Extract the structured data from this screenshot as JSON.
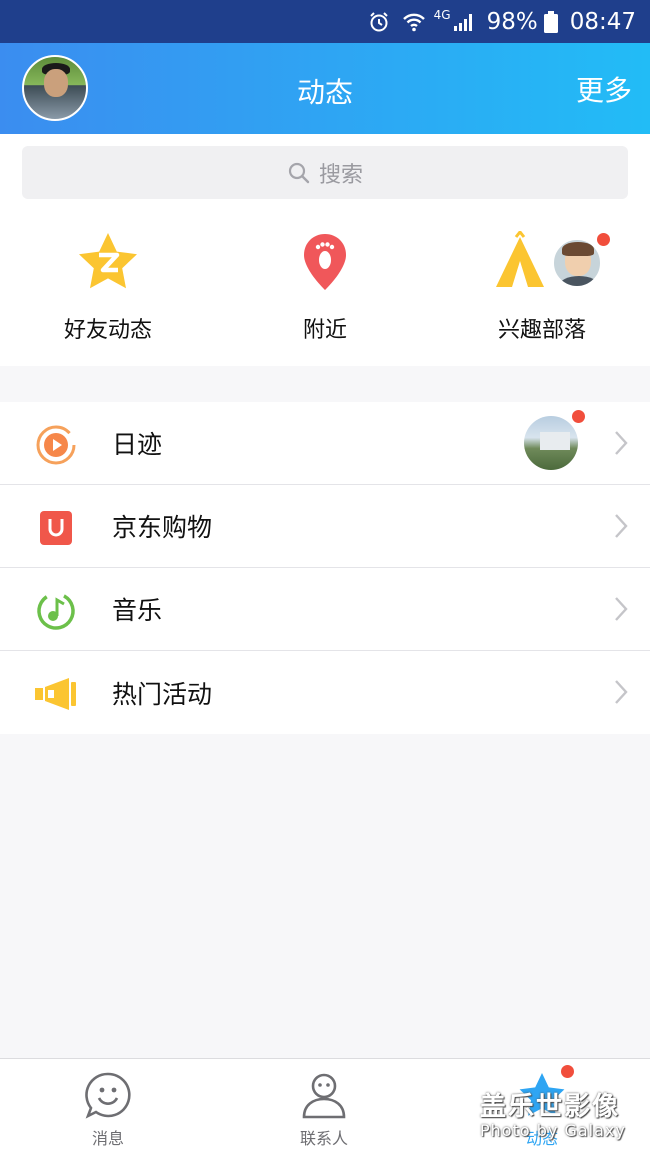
{
  "status_bar": {
    "network": "4G",
    "battery": "98%",
    "time": "08:47",
    "icons": [
      "alarm-icon",
      "wifi-icon",
      "signal-icon",
      "battery-icon"
    ]
  },
  "header": {
    "title": "动态",
    "more_label": "更多"
  },
  "search": {
    "placeholder": "搜索"
  },
  "shortcuts": [
    {
      "label": "好友动态",
      "icon": "friend-feed-star-icon"
    },
    {
      "label": "附近",
      "icon": "nearby-location-icon"
    },
    {
      "label": "兴趣部落",
      "icon": "tribe-tent-icon",
      "has_badge": true
    }
  ],
  "menu": {
    "items": [
      {
        "label": "日迹",
        "icon": "play-circle-icon",
        "has_thumbnail": true,
        "has_badge": true
      },
      {
        "label": "京东购物",
        "icon": "shopping-bag-icon"
      },
      {
        "label": "音乐",
        "icon": "music-note-icon"
      },
      {
        "label": "热门活动",
        "icon": "megaphone-icon"
      }
    ]
  },
  "tab_bar": {
    "tabs": [
      {
        "label": "消息",
        "icon": "message-smile-icon",
        "active": false
      },
      {
        "label": "联系人",
        "icon": "contacts-person-icon",
        "active": false
      },
      {
        "label": "动态",
        "icon": "star-feed-icon",
        "active": true,
        "has_badge": true
      }
    ]
  },
  "watermark": {
    "line1": "盖乐世影像",
    "line2": "Photo by Galaxy"
  },
  "colors": {
    "header_gradient_start": "#3b8df0",
    "header_gradient_end": "#22bcf6",
    "status_bar": "#1f3f8c",
    "accent": "#2ea5f3",
    "badge": "#f14e3c"
  }
}
